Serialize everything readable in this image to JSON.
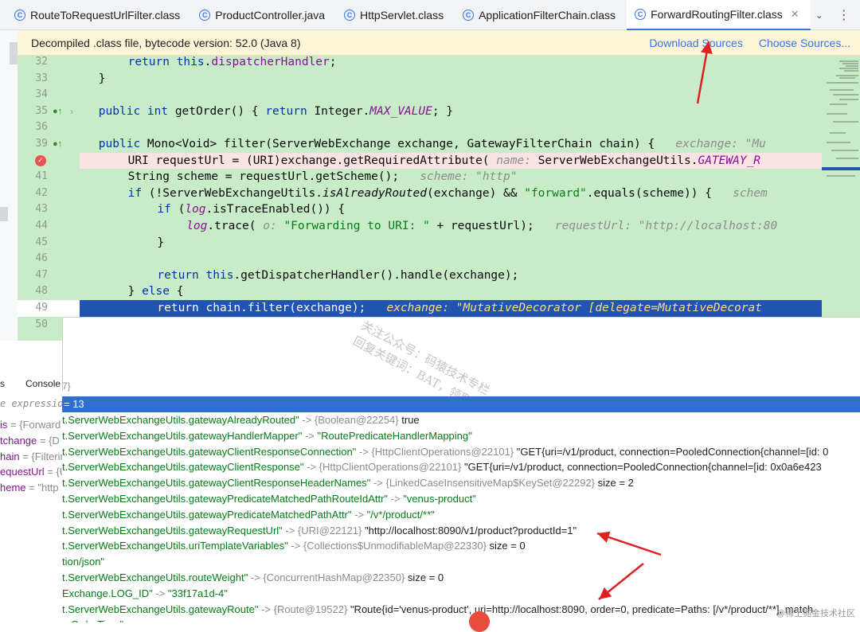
{
  "tabs": [
    {
      "label": "RouteToRequestUrlFilter.class",
      "icon": "class-icon",
      "active": false
    },
    {
      "label": "ProductController.java",
      "icon": "class-icon",
      "active": false
    },
    {
      "label": "HttpServlet.class",
      "icon": "class-icon",
      "active": false
    },
    {
      "label": "ApplicationFilterChain.class",
      "icon": "class-icon",
      "active": false
    },
    {
      "label": "ForwardRoutingFilter.class",
      "icon": "class-icon",
      "active": true
    }
  ],
  "banner": {
    "text": "Decompiled .class file, bytecode version: 52.0 (Java 8)",
    "download_sources": "Download Sources",
    "choose_sources": "Choose Sources..."
  },
  "code_lines": [
    {
      "n": "32",
      "indent": 2,
      "parts": [
        [
          "kw",
          "return "
        ],
        [
          "kw",
          "this"
        ],
        [
          "",
          "."
        ],
        [
          "fld",
          "dispatcherHandler"
        ],
        [
          "",
          ";"
        ]
      ]
    },
    {
      "n": "33",
      "indent": 1,
      "parts": [
        [
          "",
          "}"
        ]
      ]
    },
    {
      "n": "34",
      "indent": 0,
      "parts": []
    },
    {
      "n": "35",
      "indent": 1,
      "parts": [
        [
          "kw",
          "public int "
        ],
        [
          "",
          "getOrder() { "
        ],
        [
          "kw",
          "return "
        ],
        [
          "",
          "Integer."
        ],
        [
          "fld ital",
          "MAX_VALUE"
        ],
        [
          "",
          "; }"
        ]
      ]
    },
    {
      "n": "36",
      "indent": 0,
      "parts": []
    },
    {
      "n": "39",
      "indent": 1,
      "parts": [
        [
          "kw",
          "public "
        ],
        [
          "",
          "Mono<Void> filter(ServerWebExchange exchange, GatewayFilterChain chain) {   "
        ],
        [
          "hint",
          "exchange: \"Mu"
        ]
      ]
    },
    {
      "n": "",
      "indent": 2,
      "parts": [
        [
          "",
          "URI requestUrl = (URI)exchange.getRequiredAttribute( "
        ],
        [
          "hint",
          "name: "
        ],
        [
          "",
          "ServerWebExchangeUtils."
        ],
        [
          "fld ital",
          "GATEWAY_R"
        ]
      ]
    },
    {
      "n": "41",
      "indent": 2,
      "parts": [
        [
          "",
          "String scheme = requestUrl.getScheme();   "
        ],
        [
          "hint",
          "scheme: \"http\""
        ]
      ]
    },
    {
      "n": "42",
      "indent": 2,
      "parts": [
        [
          "kw",
          "if "
        ],
        [
          "",
          "(!ServerWebExchangeUtils."
        ],
        [
          "ital",
          "isAlreadyRouted"
        ],
        [
          "",
          "(exchange) && "
        ],
        [
          "str",
          "\"forward\""
        ],
        [
          "",
          ".equals(scheme)) {   "
        ],
        [
          "hint",
          "schem"
        ]
      ]
    },
    {
      "n": "43",
      "indent": 3,
      "parts": [
        [
          "kw",
          "if "
        ],
        [
          "",
          "("
        ],
        [
          "fld ital",
          "log"
        ],
        [
          "",
          ".isTraceEnabled()) {"
        ]
      ]
    },
    {
      "n": "44",
      "indent": 4,
      "parts": [
        [
          "fld ital",
          "log"
        ],
        [
          "",
          ".trace( "
        ],
        [
          "hint",
          "o: "
        ],
        [
          "str",
          "\"Forwarding to URI: \""
        ],
        [
          "",
          " + requestUrl);   "
        ],
        [
          "hint",
          "requestUrl: \"http://localhost:80"
        ]
      ]
    },
    {
      "n": "45",
      "indent": 3,
      "parts": [
        [
          "",
          "}"
        ]
      ]
    },
    {
      "n": "46",
      "indent": 0,
      "parts": []
    },
    {
      "n": "47",
      "indent": 3,
      "parts": [
        [
          "kw",
          "return this"
        ],
        [
          "",
          ".getDispatcherHandler().handle(exchange);"
        ]
      ]
    },
    {
      "n": "48",
      "indent": 2,
      "parts": [
        [
          "",
          "} "
        ],
        [
          "kw",
          "else "
        ],
        [
          "",
          "{"
        ]
      ]
    },
    {
      "n": "49",
      "indent": 3,
      "parts": [
        [
          "kw",
          "return "
        ],
        [
          "",
          "chain.filter(exchange);   "
        ],
        [
          "hint",
          "exchange: \"MutativeDecorator [delegate=MutativeDecorat"
        ]
      ]
    },
    {
      "n": "50",
      "indent": 0,
      "parts": []
    }
  ],
  "watermark": {
    "line1": "关注公众号：码猿技术专栏",
    "line2": "回复关键词：BAT，领取大厂面试真题"
  },
  "debug_panel": {
    "tab_left": "s",
    "tab_console": "Console",
    "expr_placeholder": "e expression",
    "variables": [
      {
        "name": "is",
        "value": " = {Forward"
      },
      {
        "name": "tchange",
        "value": " = {D"
      },
      {
        "name": "hain",
        "value": " = {Filterin"
      },
      {
        "name": "equestUrl",
        "value": " = {U"
      },
      {
        "name": "heme",
        "value": " = \"http"
      }
    ]
  },
  "result": {
    "header": "= 13",
    "hint": "7}"
  },
  "rows": [
    {
      "k": "t.ServerWebExchangeUtils.gatewayAlreadyRouted\"",
      "t": " -> {Boolean@22254}",
      "v": " true",
      "vs": ""
    },
    {
      "k": "t.ServerWebExchangeUtils.gatewayHandlerMapper\"",
      "t": " -> ",
      "v": "",
      "vs": "\"RoutePredicateHandlerMapping\""
    },
    {
      "k": "t.ServerWebExchangeUtils.gatewayClientResponseConnection\"",
      "t": " -> {HttpClientOperations@22101}",
      "v": " \"GET{uri=/v1/product, connection=PooledConnection{channel=[id: 0",
      "vs": ""
    },
    {
      "k": "t.ServerWebExchangeUtils.gatewayClientResponse\"",
      "t": " -> {HttpClientOperations@22101}",
      "v": " \"GET{uri=/v1/product, connection=PooledConnection{channel=[id: 0x0a6e423",
      "vs": ""
    },
    {
      "k": "t.ServerWebExchangeUtils.gatewayClientResponseHeaderNames\"",
      "t": " -> {LinkedCaseInsensitiveMap$KeySet@22292}",
      "v": "  size = 2",
      "vs": ""
    },
    {
      "k": "t.ServerWebExchangeUtils.gatewayPredicateMatchedPathRouteIdAttr\"",
      "t": " -> ",
      "v": "",
      "vs": "\"venus-product\""
    },
    {
      "k": "t.ServerWebExchangeUtils.gatewayPredicateMatchedPathAttr\"",
      "t": " -> ",
      "v": "",
      "vs": "\"/v*/product/**\""
    },
    {
      "k": "t.ServerWebExchangeUtils.gatewayRequestUrl\"",
      "t": " -> {URI@22121}",
      "v": " \"http://localhost:8090/v1/product?productId=1\"",
      "vs": ""
    },
    {
      "k": "t.ServerWebExchangeUtils.uriTemplateVariables\"",
      "t": " -> {Collections$UnmodifiableMap@22330}",
      "v": "  size = 0",
      "vs": ""
    },
    {
      "k": "tion/json\"",
      "t": "",
      "v": "",
      "vs": ""
    },
    {
      "k": "t.ServerWebExchangeUtils.routeWeight\"",
      "t": " -> {ConcurrentHashMap@22350}",
      "v": "  size = 0",
      "vs": ""
    },
    {
      "k": "Exchange.LOG_ID\"",
      "t": " -> ",
      "v": "",
      "vs": "\"33f17a1d-4\""
    },
    {
      "k": "t.ServerWebExchangeUtils.gatewayRoute\"",
      "t": " -> {Route@19522}",
      "v": " \"Route{id='venus-product', uri=http://localhost:8090, order=0, predicate=Paths: [/v*/product/**], match",
      "vs": ""
    },
    {
      "k": "...OrderTime\"",
      "t": "",
      "v": "",
      "vs": ""
    }
  ],
  "corner_mark": "@稀土掘金技术社区",
  "colors": {
    "editor_bg": "#c8ecc8",
    "exec_line": "#2154b0",
    "breakpoint_line": "#fae3e3",
    "result_header": "#2f6fcd",
    "annotation_arrow": "#e02020"
  }
}
